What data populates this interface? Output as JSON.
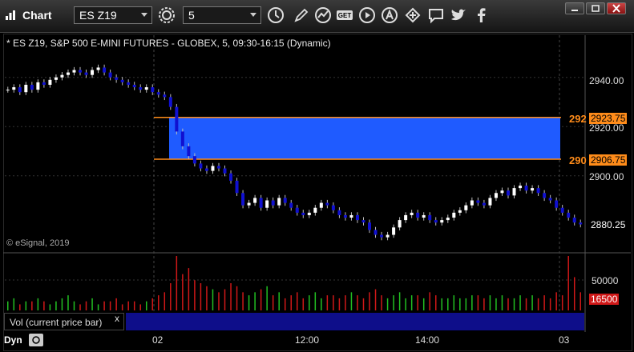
{
  "window": {
    "title": "Chart",
    "symbol": "ES Z19",
    "interval": "5"
  },
  "chart": {
    "header": "* ES Z19, S&P 500 E-MINI FUTURES - GLOBEX, 5, 09:30-16:15 (Dynamic)",
    "copyright": "© eSignal, 2019",
    "price_labels": [
      "2940.00",
      "2920.00",
      "2900.00"
    ],
    "last_price": "2880.25",
    "zone_top_value": "2923.75",
    "zone_bottom_value": "2906.75",
    "zone_top_short": "292",
    "zone_bottom_short": "290",
    "volume_label": "50000",
    "volume_current": "16500",
    "study_name": "Vol (current price bar)",
    "study_close": "x",
    "time_labels": [
      "02",
      "12:00",
      "14:00",
      "03"
    ],
    "dyn_label": "Dyn",
    "colors": {
      "zone": "#1f5bff",
      "zone_line": "#ff8c1a",
      "up_candle": "#ffffff",
      "down_candle": "#1010d0",
      "vol_up": "#22c022",
      "vol_down": "#d01818"
    }
  },
  "chart_data": {
    "type": "candlestick",
    "y_range": [
      2870,
      2950
    ],
    "zone": {
      "high": 2923.75,
      "low": 2906.75
    },
    "closes": [
      2935,
      2936,
      2934,
      2937,
      2935,
      2938,
      2937,
      2939,
      2940,
      2941,
      2942,
      2943,
      2942,
      2941,
      2943,
      2944,
      2942,
      2940,
      2939,
      2938,
      2937,
      2936,
      2935,
      2936,
      2934,
      2933,
      2932,
      2928,
      2918,
      2912,
      2908,
      2905,
      2903,
      2902,
      2904,
      2903,
      2901,
      2898,
      2893,
      2888,
      2889,
      2891,
      2887,
      2890,
      2888,
      2891,
      2889,
      2887,
      2885,
      2884,
      2885,
      2887,
      2889,
      2888,
      2886,
      2884,
      2883,
      2884,
      2882,
      2881,
      2878,
      2876,
      2875,
      2876,
      2879,
      2882,
      2884,
      2885,
      2883,
      2884,
      2882,
      2881,
      2882,
      2883,
      2885,
      2886,
      2888,
      2890,
      2889,
      2888,
      2891,
      2893,
      2894,
      2892,
      2895,
      2896,
      2894,
      2895,
      2893,
      2891,
      2890,
      2887,
      2885,
      2883,
      2881,
      2880.25
    ],
    "volume": [
      3,
      4,
      2,
      3,
      3,
      4,
      3,
      2,
      3,
      4,
      5,
      3,
      2,
      3,
      4,
      2,
      3,
      3,
      4,
      2,
      3,
      3,
      2,
      3,
      4,
      5,
      6,
      9,
      18,
      12,
      14,
      10,
      9,
      8,
      7,
      6,
      7,
      9,
      8,
      6,
      5,
      6,
      7,
      8,
      5,
      6,
      4,
      5,
      6,
      4,
      5,
      6,
      4,
      5,
      5,
      4,
      5,
      6,
      5,
      4,
      6,
      7,
      5,
      4,
      5,
      6,
      4,
      5,
      5,
      4,
      6,
      5,
      4,
      4,
      5,
      4,
      4,
      5,
      5,
      4,
      5,
      4,
      5,
      4,
      4,
      5,
      4,
      5,
      4,
      5,
      4,
      6,
      5,
      18,
      11,
      6
    ]
  }
}
